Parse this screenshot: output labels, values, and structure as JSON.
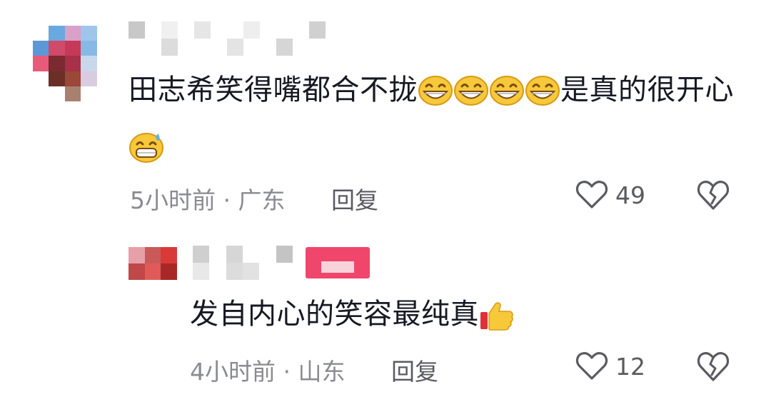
{
  "comment": {
    "text_part1": "田志希笑得嘴都合不拢",
    "emojis_inline": [
      "grin-emoji",
      "grin-emoji",
      "grin-emoji",
      "grin-emoji"
    ],
    "text_part2": "是真的很开心",
    "trailing_emoji": "sweat-grin-emoji",
    "time": "5小时前",
    "separator": "·",
    "location": "广东",
    "reply_label": "回复",
    "like_count": "49"
  },
  "reply": {
    "text": "发自内心的笑容最纯真",
    "trailing_emoji": "thumbs-up-emoji",
    "time": "4小时前",
    "separator": "·",
    "location": "山东",
    "reply_label": "回复",
    "like_count": "12"
  },
  "colors": {
    "text": "#161823",
    "meta_gray": "#8a8b91",
    "author_tag": "#f0466c"
  }
}
